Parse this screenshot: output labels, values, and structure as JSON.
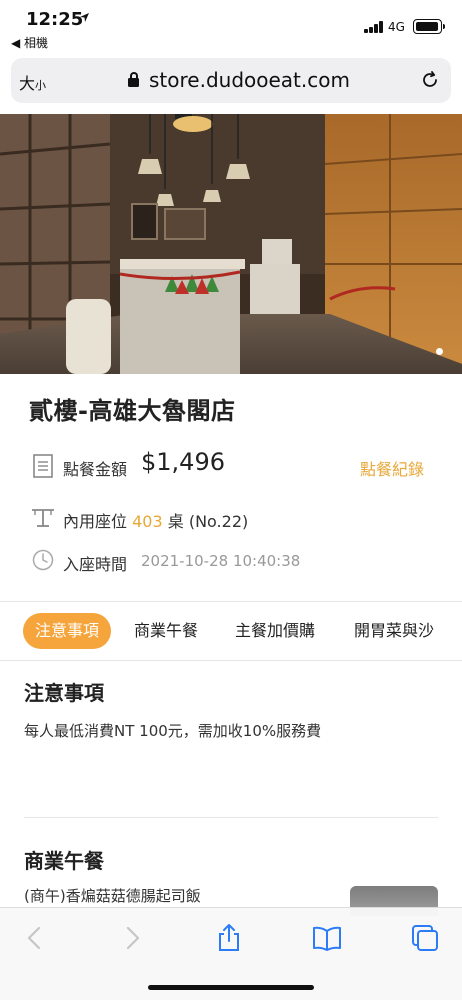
{
  "status_bar": {
    "time": "12:25",
    "back_app": "◀ 相機",
    "network": "4G"
  },
  "url_bar": {
    "text_size_big": "大",
    "text_size_small": "小",
    "url": "store.dudooeat.com"
  },
  "hero": {
    "image": "restaurant-interior-photo",
    "page_indicator": {
      "count": 1,
      "current": 1
    }
  },
  "store": {
    "name": "貳樓-高雄大魯閣店",
    "order_label": "點餐金額",
    "order_amount": "$1,496",
    "order_history_label": "點餐紀錄",
    "seat_label": "內用座位",
    "seat_number": "403",
    "seat_suffix": "桌 (No.22)",
    "time_label": "入座時間",
    "time_value": "2021-10-28 10:40:38"
  },
  "tabs": [
    {
      "label": "注意事項",
      "active": true
    },
    {
      "label": "商業午餐",
      "active": false
    },
    {
      "label": "主餐加價購",
      "active": false
    },
    {
      "label": "開胃菜與沙",
      "active": false
    }
  ],
  "sections": {
    "notice_title": "注意事項",
    "notice_text": "每人最低消費NT 100元，需加收10%服務費",
    "lunch_title": "商業午餐",
    "lunch_first_item": "(商午)香煸菇菇德腸起司飯"
  },
  "colors": {
    "accent": "#f5a53c",
    "accent_text": "#e8a838"
  }
}
